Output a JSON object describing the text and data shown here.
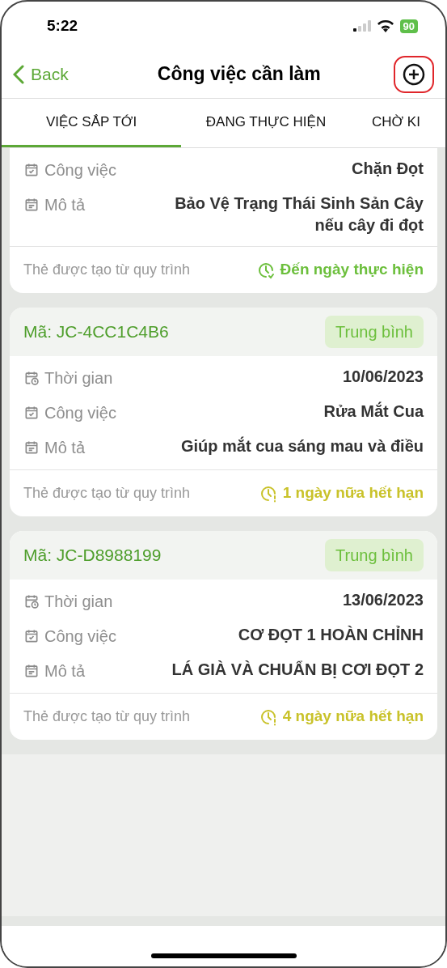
{
  "status_bar": {
    "time": "5:22",
    "battery": "90"
  },
  "nav": {
    "back": "Back",
    "title": "Công việc cần làm"
  },
  "tabs": [
    {
      "label": "VIỆC SẮP TỚI",
      "selected": true
    },
    {
      "label": "ĐANG THỰC HIỆN",
      "selected": false
    },
    {
      "label": "CHỜ KI",
      "selected": false
    }
  ],
  "cards": [
    {
      "rows": [
        {
          "kind": "task",
          "label": "Công việc",
          "value": "Chặn Đọt"
        },
        {
          "kind": "description",
          "label": "Mô tả",
          "value": "Bảo Vệ Trạng Thái Sinh Sản Cây nếu cây đi đọt"
        }
      ],
      "source": "Thẻ được tạo từ quy trình",
      "status": {
        "kind": "due",
        "text": "Đến ngày thực hiện"
      }
    },
    {
      "code": "Mã: JC-4CC1C4B6",
      "priority": "Trung bình",
      "rows": [
        {
          "kind": "time",
          "label": "Thời gian",
          "value": "10/06/2023"
        },
        {
          "kind": "task",
          "label": "Công việc",
          "value": "Rửa Mắt Cua"
        },
        {
          "kind": "description",
          "label": "Mô tả",
          "value": "Giúp mắt cua sáng mau và điều"
        }
      ],
      "source": "Thẻ được tạo từ quy trình",
      "status": {
        "kind": "expiring",
        "text": "1 ngày nữa hết hạn"
      }
    },
    {
      "code": "Mã: JC-D8988199",
      "priority": "Trung bình",
      "rows": [
        {
          "kind": "time",
          "label": "Thời gian",
          "value": "13/06/2023"
        },
        {
          "kind": "task",
          "label": "Công việc",
          "value": "CƠ ĐỌT 1 HOÀN CHỈNH"
        },
        {
          "kind": "description",
          "label": "Mô tả",
          "value": "LÁ GIÀ VÀ CHUẨN BỊ CƠI ĐỌT 2"
        }
      ],
      "source": "Thẻ được tạo từ quy trình",
      "status": {
        "kind": "expiring",
        "text": "4 ngày nữa hết hạn"
      }
    }
  ]
}
